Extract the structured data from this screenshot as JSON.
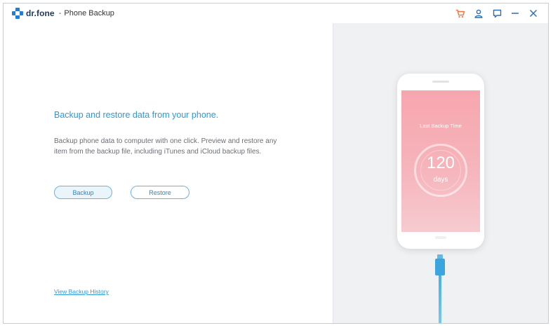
{
  "app": {
    "brand_name": "dr.fone",
    "separator": "-",
    "module_name": "Phone Backup"
  },
  "title_bar_icons": [
    "cart-icon",
    "user-icon",
    "feedback-icon",
    "minimize-icon",
    "close-icon"
  ],
  "colors": {
    "accent_blue": "#2c9ad8",
    "logo_blue": "#1f7ed6",
    "cart_orange": "#f0743c",
    "screen_pink": "#f7a6ae",
    "cable_blue": "#3aa6dd"
  },
  "main": {
    "headline": "Backup and restore data from your phone.",
    "description": "Backup phone data to computer with one click. Preview and restore any item from the backup file, including iTunes and iCloud backup files.",
    "backup_label": "Backup",
    "restore_label": "Restore",
    "history_link": "View Backup History"
  },
  "phone_card": {
    "label": "Last Backup Time",
    "days_value": "120",
    "days_unit": "days"
  }
}
